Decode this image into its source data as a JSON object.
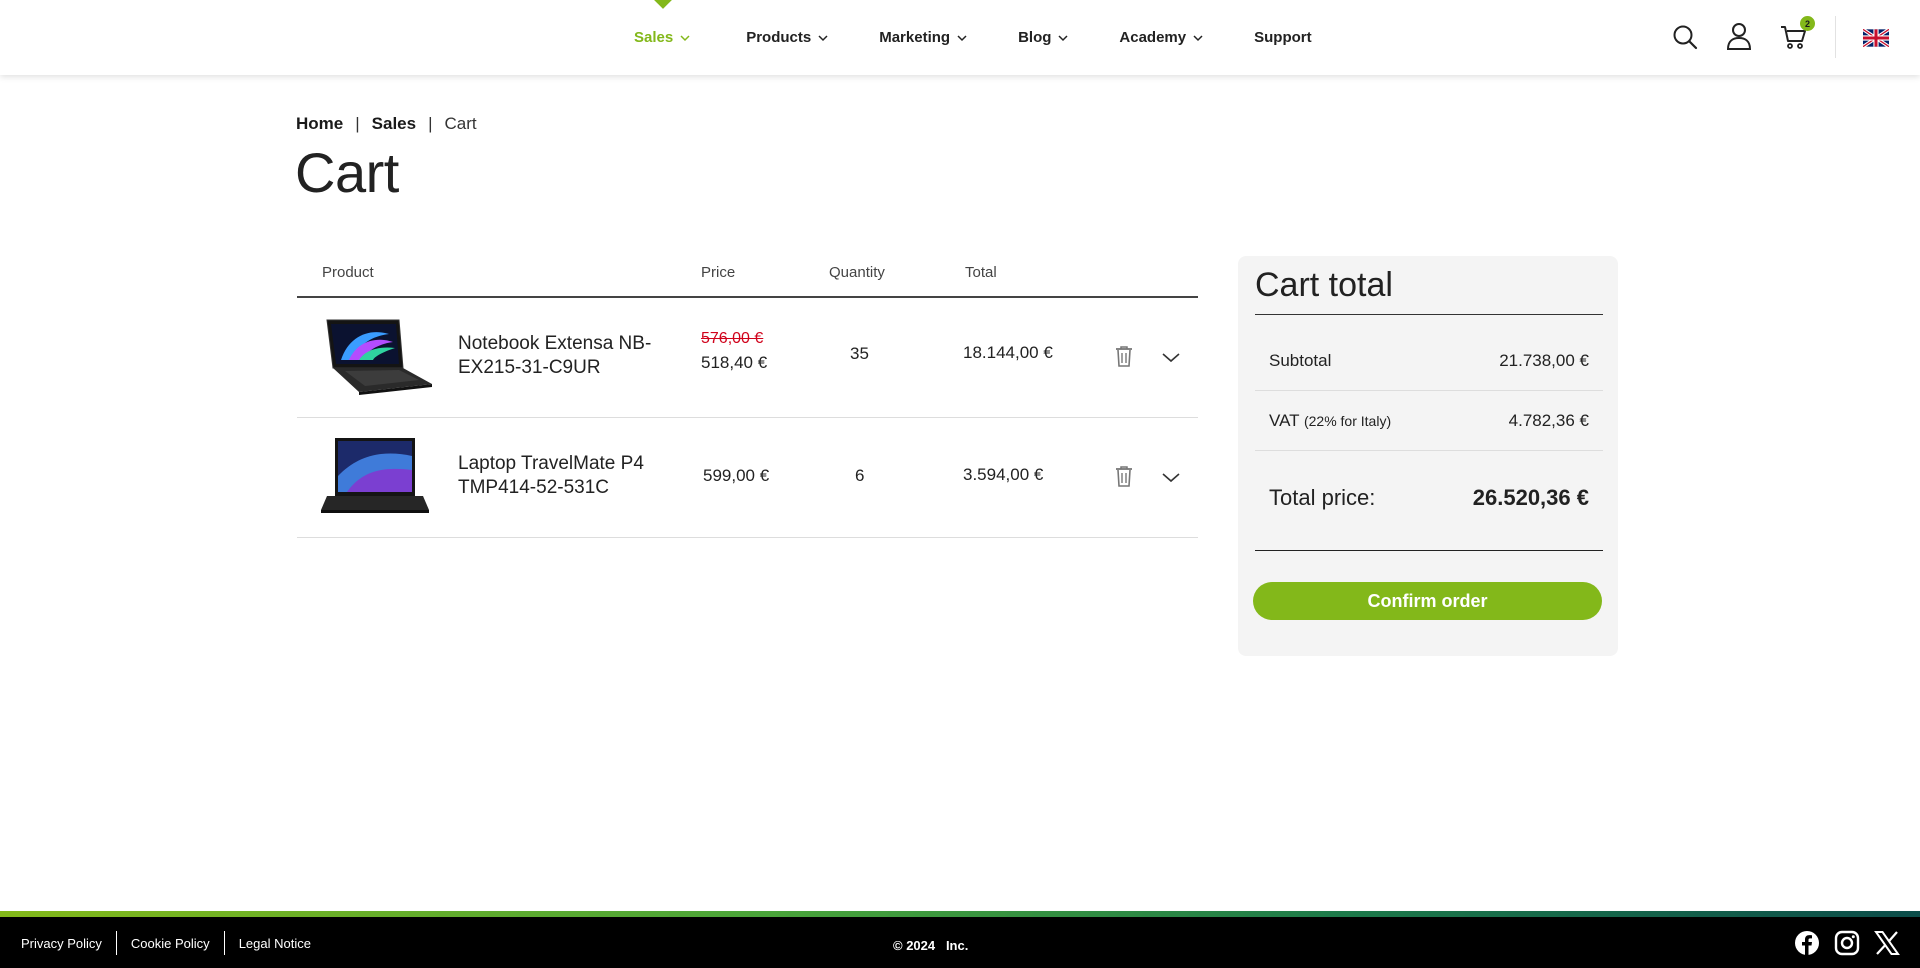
{
  "nav": {
    "items": [
      {
        "label": "Sales",
        "active": true
      },
      {
        "label": "Products"
      },
      {
        "label": "Marketing"
      },
      {
        "label": "Blog"
      },
      {
        "label": "Academy"
      },
      {
        "label": "Support"
      }
    ]
  },
  "header": {
    "cart_count": "2"
  },
  "breadcrumb": {
    "home": "Home",
    "sales": "Sales",
    "current": "Cart",
    "separator": "|"
  },
  "page": {
    "title": "Cart"
  },
  "table": {
    "headers": {
      "product": "Product",
      "price": "Price",
      "quantity": "Quantity",
      "total": "Total"
    },
    "rows": [
      {
        "name": "Notebook Extensa NB-EX215-31-C9UR",
        "old_price": "576,00 €",
        "price": "518,40 €",
        "quantity": "35",
        "total": "18.144,00 €"
      },
      {
        "name": "Laptop TravelMate P4 TMP414-52-531C",
        "price": "599,00 €",
        "quantity": "6",
        "total": "3.594,00 €"
      }
    ]
  },
  "summary": {
    "title": "Cart total",
    "subtotal_label": "Subtotal",
    "subtotal_value": "21.738,00 €",
    "vat_label": "VAT",
    "vat_note": "(22% for Italy)",
    "vat_value": "4.782,36 €",
    "total_label": "Total price:",
    "total_value": "26.520,36 €",
    "confirm_label": "Confirm order"
  },
  "footer": {
    "links": [
      "Privacy Policy",
      "Cookie Policy",
      "Legal Notice"
    ],
    "copyright": "© 2024   Inc."
  },
  "colors": {
    "accent": "#83b81a",
    "strikethrough": "#d0021b"
  }
}
